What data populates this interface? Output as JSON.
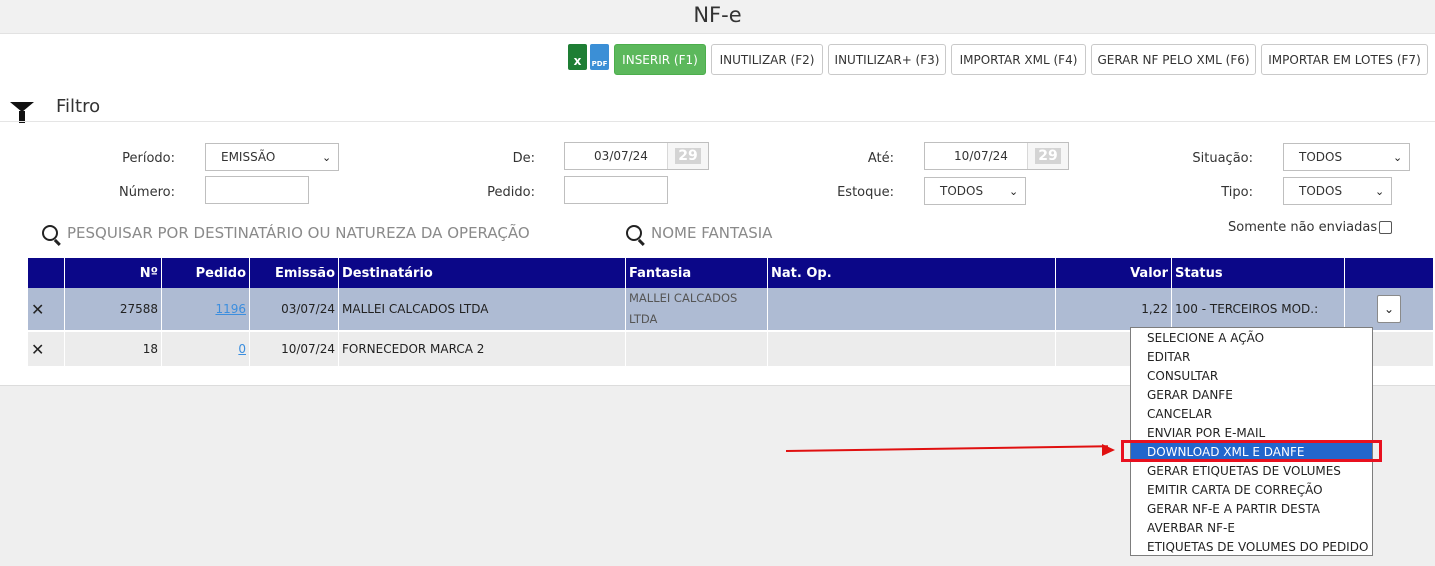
{
  "page": {
    "title": "NF-e"
  },
  "toolbar": {
    "excel_icon_text": "x",
    "pdf_icon_text": "PDF",
    "buttons": [
      {
        "label": "INSERIR (F1)"
      },
      {
        "label": "INUTILIZAR (F2)"
      },
      {
        "label": "INUTILIZAR+ (F3)"
      },
      {
        "label": "IMPORTAR XML (F4)"
      },
      {
        "label": "GERAR NF PELO XML (F6)"
      },
      {
        "label": "IMPORTAR EM LOTES (F7)"
      }
    ]
  },
  "filter": {
    "title": "Filtro",
    "periodo": {
      "label": "Período:",
      "value": "EMISSÃO"
    },
    "de": {
      "label": "De:",
      "value": "03/07/24",
      "cal": "29"
    },
    "ate": {
      "label": "Até:",
      "value": "10/07/24",
      "cal": "29"
    },
    "situacao": {
      "label": "Situação:",
      "value": "TODOS"
    },
    "numero": {
      "label": "Número:",
      "value": ""
    },
    "pedido": {
      "label": "Pedido:",
      "value": ""
    },
    "estoque": {
      "label": "Estoque:",
      "value": "TODOS"
    },
    "tipo": {
      "label": "Tipo:",
      "value": "TODOS"
    },
    "search_dest": {
      "placeholder": "PESQUISAR POR DESTINATÁRIO OU NATUREZA DA OPERAÇÃO"
    },
    "search_fantasia": {
      "placeholder": "NOME FANTASIA"
    },
    "somente_nao_enviadas": {
      "label": "Somente não enviadas",
      "checked": false
    }
  },
  "table": {
    "headers": {
      "num": "Nº",
      "pedido": "Pedido",
      "emissao": "Emissão",
      "destinatario": "Destinatário",
      "fantasia": "Fantasia",
      "natop": "Nat. Op.",
      "valor": "Valor",
      "status": "Status"
    },
    "rows": [
      {
        "num": "27588",
        "pedido": "1196",
        "emissao": "03/07/24",
        "destinatario": "MALLEI CALCADOS LTDA",
        "fantasia": "MALLEI CALCADOS LTDA",
        "natop": "",
        "valor": "1,22",
        "status": "100 - TERCEIROS MOD.:"
      },
      {
        "num": "18",
        "pedido": "0",
        "emissao": "10/07/24",
        "destinatario": "FORNECEDOR MARCA 2",
        "fantasia": "",
        "natop": "",
        "valor": "",
        "status": ""
      }
    ]
  },
  "action_menu": {
    "items": [
      "SELECIONE A AÇÃO",
      "EDITAR",
      "CONSULTAR",
      "GERAR DANFE",
      "CANCELAR",
      "ENVIAR POR E-MAIL",
      "DOWNLOAD XML E DANFE",
      "GERAR ETIQUETAS DE VOLUMES",
      "EMITIR CARTA DE CORREÇÃO",
      "GERAR NF-E A PARTIR DESTA",
      "AVERBAR NF-E",
      "ETIQUETAS DE VOLUMES DO PEDIDO"
    ],
    "highlighted": "DOWNLOAD XML E DANFE"
  },
  "colors": {
    "header_bg": "#0b0788",
    "primary_btn": "#5cb85c",
    "selected_row": "#aebbd3",
    "highlight": "#2266cc",
    "annotation": "#e01010"
  }
}
